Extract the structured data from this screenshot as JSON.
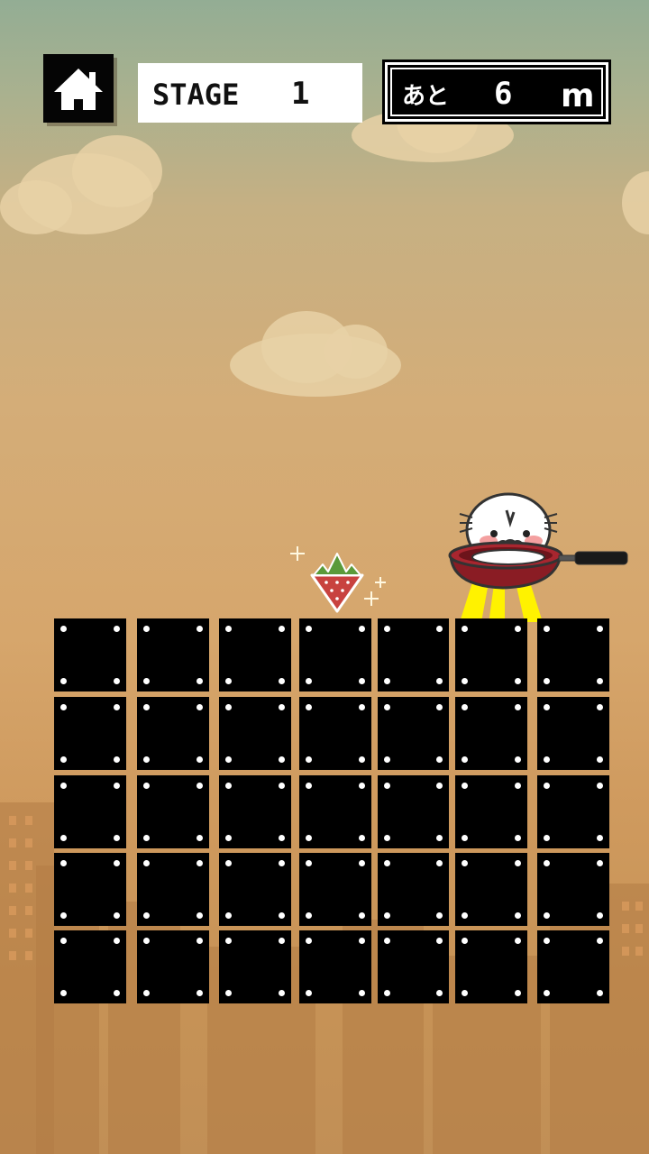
{
  "hud": {
    "home_icon": "home-icon",
    "stage_label": "STAGE",
    "stage_number": "1",
    "remaining_label": "あと",
    "remaining_value": "6",
    "remaining_unit": "m"
  },
  "scene": {
    "item": "strawberry-icon",
    "character": "seal-in-frying-pan"
  },
  "board": {
    "rows": 5,
    "columns": 7
  },
  "colors": {
    "tile": "#000000",
    "tile_dot": "#ffffff",
    "sky_top": "#93ad94",
    "sky_bottom": "#c18f56"
  }
}
